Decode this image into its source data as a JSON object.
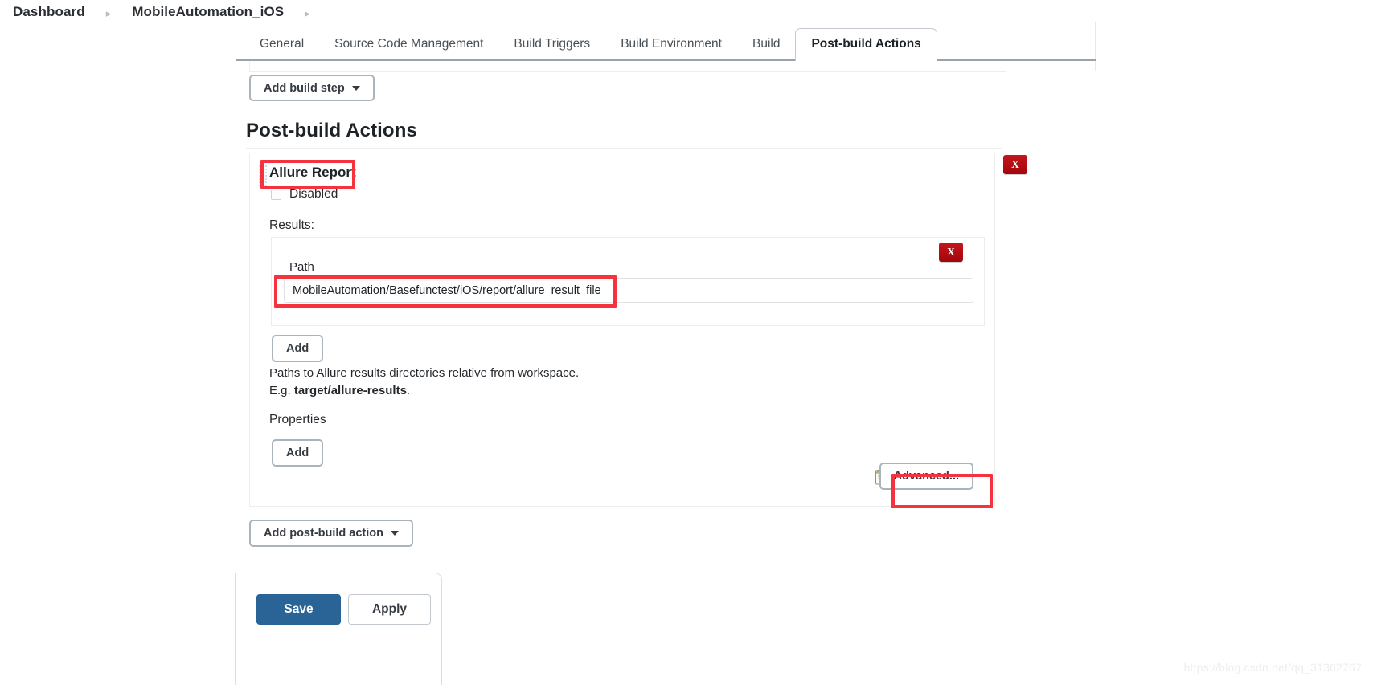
{
  "breadcrumb": {
    "items": [
      {
        "label": "Dashboard"
      },
      {
        "label": "MobileAutomation_iOS"
      }
    ],
    "separator": "▸"
  },
  "tabs": [
    {
      "label": "General",
      "active": false
    },
    {
      "label": "Source Code Management",
      "active": false
    },
    {
      "label": "Build Triggers",
      "active": false
    },
    {
      "label": "Build Environment",
      "active": false
    },
    {
      "label": "Build",
      "active": false
    },
    {
      "label": "Post-build Actions",
      "active": true
    }
  ],
  "toolbar": {
    "add_build_step_label": "Add build step",
    "add_post_build_action_label": "Add post-build action"
  },
  "section": {
    "title": "Post-build Actions"
  },
  "post_build_action": {
    "name": "Allure Report",
    "remove_label": "X",
    "disabled_checkbox": {
      "label": "Disabled",
      "checked": false
    },
    "results": {
      "label": "Results:",
      "entry_remove_label": "X",
      "path_label": "Path",
      "path_value": "MobileAutomation/Basefunctest/iOS/report/allure_result_file",
      "path_placeholder": "",
      "add_label": "Add",
      "help_line1": "Paths to Allure results directories relative from workspace.",
      "help_line2_prefix": "E.g. ",
      "help_line2_strong": "target/allure-results",
      "help_line2_suffix": "."
    },
    "properties": {
      "label": "Properties",
      "add_label": "Add"
    },
    "advanced_label": "Advanced...",
    "advanced_icon": "notepad-pencil-icon"
  },
  "footer": {
    "save_label": "Save",
    "apply_label": "Apply"
  },
  "watermark": "https://blog.csdn.net/qq_31362767",
  "colors": {
    "accent_blue": "#2a6496",
    "danger_red": "#b31217",
    "annotation_red": "#f5333f",
    "border_gray": "#a9b4bd"
  }
}
